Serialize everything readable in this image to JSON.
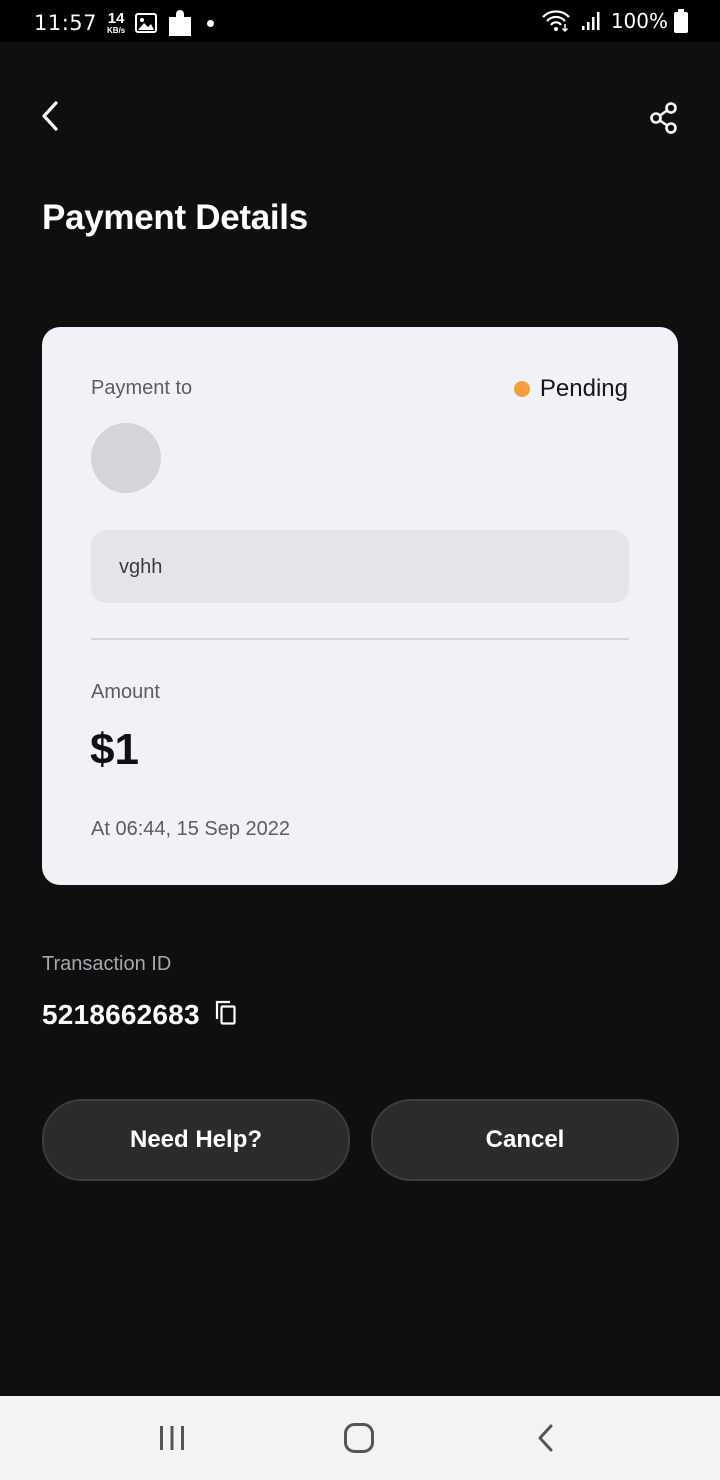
{
  "status_bar": {
    "time": "11:57",
    "net_speed_value": "14",
    "net_speed_unit": "KB/s",
    "battery": "100%",
    "icons": [
      "image-icon",
      "puzzle-icon",
      "dot-icon",
      "wifi-icon",
      "signal-icon",
      "battery-icon"
    ]
  },
  "header": {
    "back_icon": "chevron-left-icon",
    "share_icon": "share-icon",
    "title": "Payment Details"
  },
  "card": {
    "payment_to_label": "Payment to",
    "status": {
      "label": "Pending",
      "color": "#f59e3a"
    },
    "note": "vghh",
    "amount_label": "Amount",
    "amount": "$1",
    "timestamp": "At 06:44, 15 Sep 2022"
  },
  "transaction": {
    "label": "Transaction ID",
    "id": "5218662683",
    "copy_icon": "copy-icon"
  },
  "actions": {
    "help": "Need Help?",
    "cancel": "Cancel"
  },
  "nav_bar": {
    "icons": [
      "recents-icon",
      "home-icon",
      "back-icon"
    ]
  },
  "colors": {
    "background": "#0f0f0f",
    "card": "#f1f2f7",
    "button": "#2b2b2d",
    "status_pending": "#f59e3a"
  }
}
